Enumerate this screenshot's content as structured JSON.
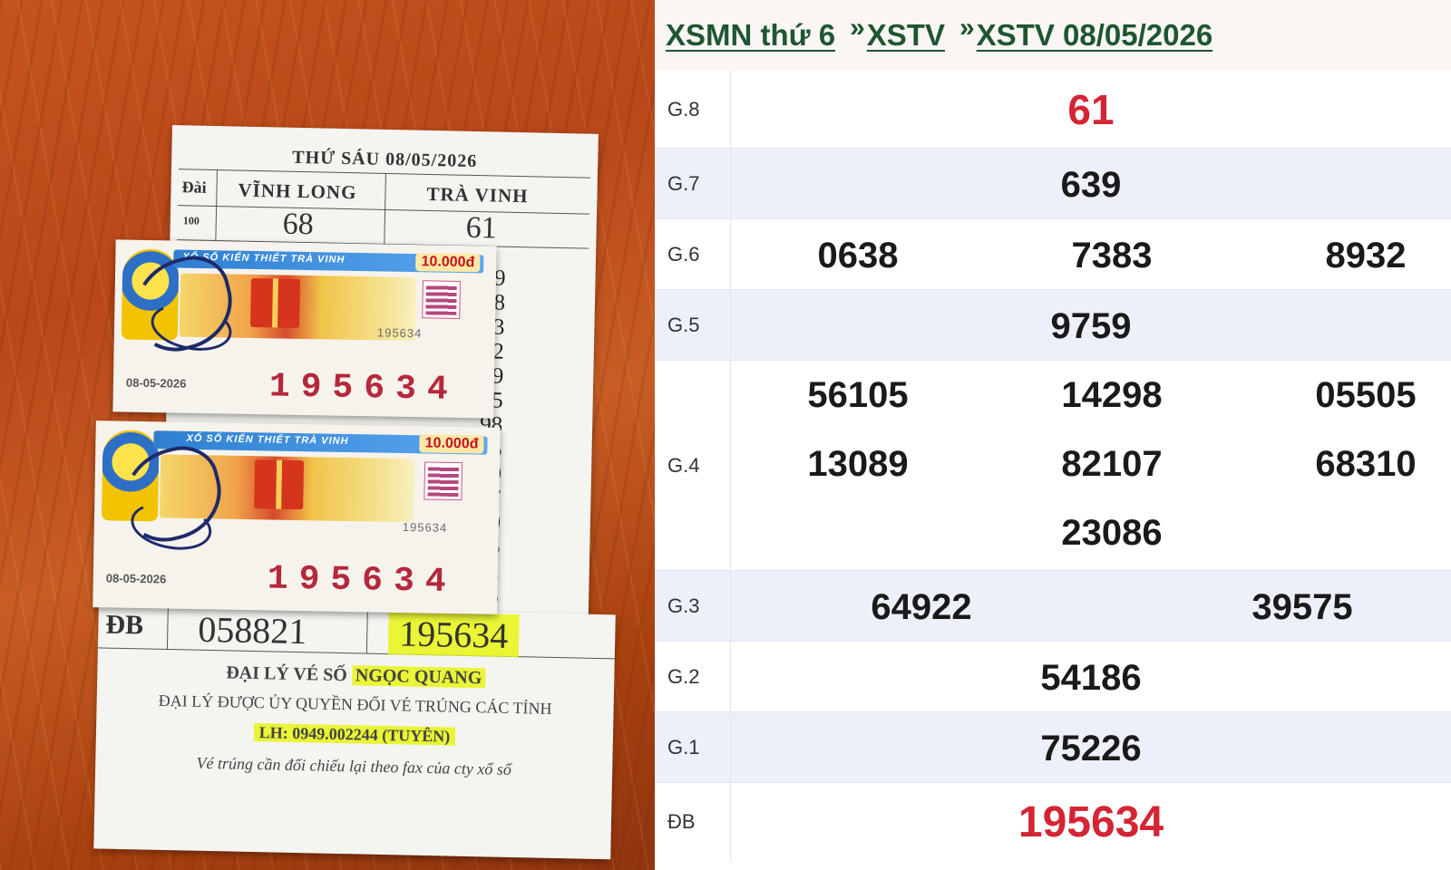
{
  "photo": {
    "sheet": {
      "title": "THỨ SÁU 08/05/2026",
      "col_label": "Đài",
      "province1": "VĨNH LONG",
      "province2": "TRÀ VINH",
      "row_label_100": "100",
      "vl_g8": "68",
      "tv_g8": "61",
      "tv_column_digits": [
        "39",
        "38",
        "33",
        "32",
        "59",
        "05",
        "98",
        "05",
        "89",
        "07",
        "10",
        "86",
        "22",
        "75",
        "86",
        "26"
      ],
      "db_label": "ĐB",
      "db_vinh_long": "058821",
      "db_tra_vinh": "195634",
      "agent_line_prefix": "ĐẠI LÝ VÉ SỐ",
      "agent_name": "NGỌC QUANG",
      "authorized_line": "ĐẠI LÝ ĐƯỢC ỦY QUYỀN ĐỔI VÉ TRÚNG CÁC TỈNH",
      "contact": "LH: 0949.002244 (TUYÊN)",
      "disclaimer": "Vé trúng cần đối chiếu lại theo fax của cty xổ số"
    },
    "tickets": [
      {
        "header": "XỔ SỐ KIẾN THIẾT TRÀ VINH",
        "price": "10.000đ",
        "serial_small": "195634",
        "date": "08-05-2026",
        "number": "195634"
      },
      {
        "header": "XỔ SỐ KIẾN THIẾT TRÀ VINH",
        "price": "10.000đ",
        "serial_small": "195634",
        "date": "08-05-2026",
        "number": "195634"
      }
    ]
  },
  "breadcrumb": {
    "item1": "XSMN thứ 6",
    "sep": "»",
    "item2": "XSTV",
    "item3": "XSTV 08/05/2026"
  },
  "results": {
    "g8": {
      "label": "G.8",
      "values": [
        "61"
      ]
    },
    "g7": {
      "label": "G.7",
      "values": [
        "639"
      ]
    },
    "g6": {
      "label": "G.6",
      "values": [
        "0638",
        "7383",
        "8932"
      ]
    },
    "g5": {
      "label": "G.5",
      "values": [
        "9759"
      ]
    },
    "g4": {
      "label": "G.4",
      "values": [
        "56105",
        "14298",
        "05505",
        "13089",
        "82107",
        "68310",
        "23086"
      ]
    },
    "g3": {
      "label": "G.3",
      "values": [
        "64922",
        "39575"
      ]
    },
    "g2": {
      "label": "G.2",
      "values": [
        "54186"
      ]
    },
    "g1": {
      "label": "G.1",
      "values": [
        "75226"
      ]
    },
    "db": {
      "label": "ĐB",
      "values": [
        "195634"
      ]
    }
  },
  "colors": {
    "breadcrumb_green": "#1e5631",
    "highlight_red": "#d42535",
    "alt_row": "#edf0f8"
  }
}
